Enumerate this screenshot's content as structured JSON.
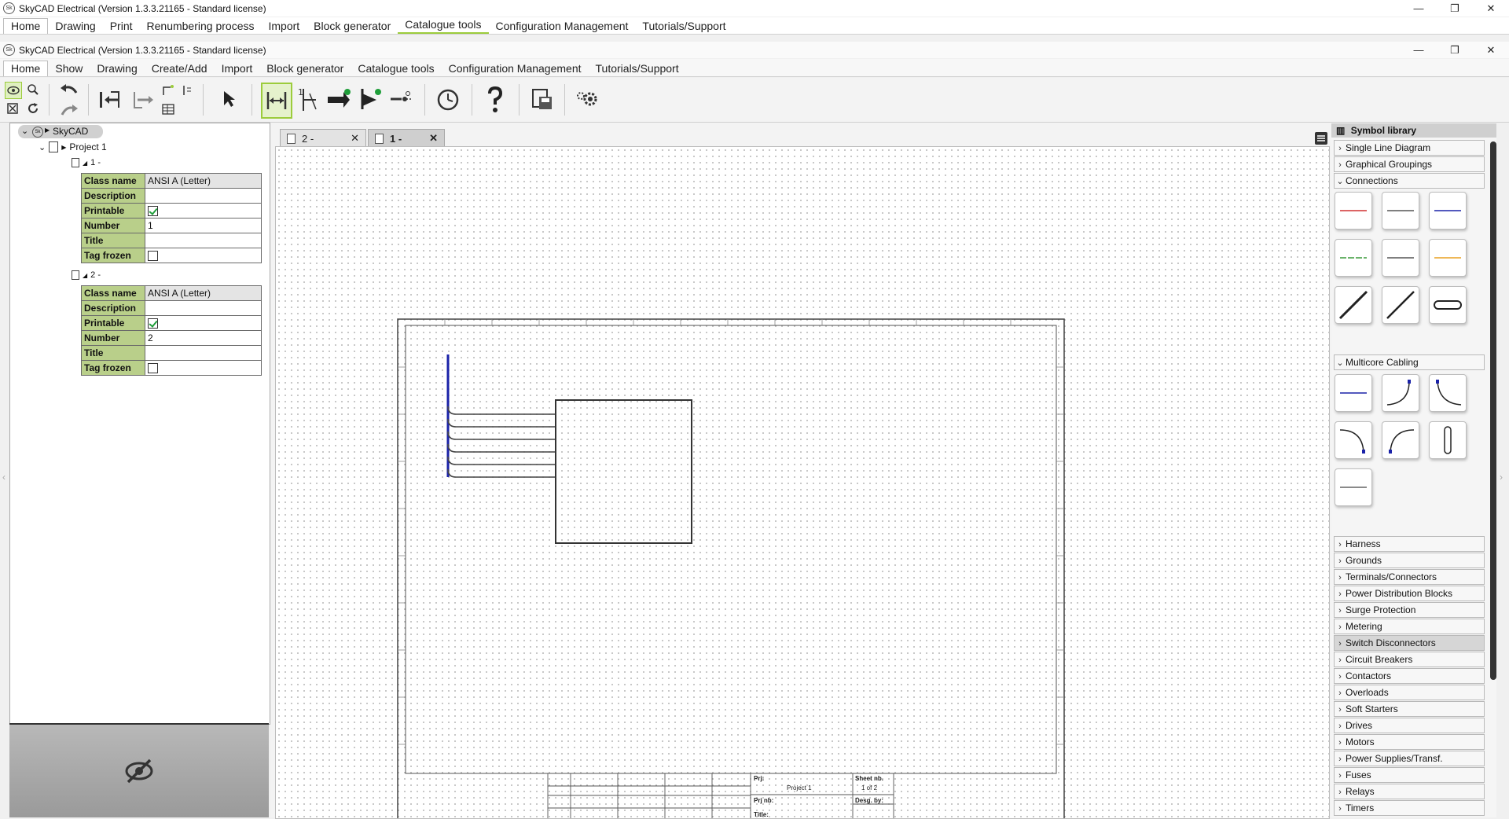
{
  "outer_window": {
    "title": "SkyCAD Electrical (Version 1.3.3.21165 - Standard license)",
    "menu": [
      "Home",
      "Drawing",
      "Print",
      "Renumbering process",
      "Import",
      "Block generator",
      "Catalogue tools",
      "Configuration Management",
      "Tutorials/Support"
    ]
  },
  "inner_window": {
    "title": "SkyCAD Electrical (Version 1.3.3.21165 - Standard license)",
    "menu": [
      "Home",
      "Show",
      "Drawing",
      "Create/Add",
      "Import",
      "Block generator",
      "Catalogue tools",
      "Configuration Management",
      "Tutorials/Support"
    ]
  },
  "window_controls": [
    "—",
    "❐",
    "✕"
  ],
  "tree": {
    "root": "SkyCAD",
    "project": "Project 1",
    "pages": [
      {
        "label": "1 -",
        "props": [
          {
            "key": "Class name",
            "value": "ANSI A (Letter)"
          },
          {
            "key": "Description",
            "value": ""
          },
          {
            "key": "Printable",
            "value": "",
            "checked": true
          },
          {
            "key": "Number",
            "value": "1"
          },
          {
            "key": "Title",
            "value": ""
          },
          {
            "key": "Tag frozen",
            "value": "",
            "checked": false
          }
        ]
      },
      {
        "label": "2 -",
        "props": [
          {
            "key": "Class name",
            "value": "ANSI A (Letter)"
          },
          {
            "key": "Description",
            "value": ""
          },
          {
            "key": "Printable",
            "value": "",
            "checked": true
          },
          {
            "key": "Number",
            "value": "2"
          },
          {
            "key": "Title",
            "value": ""
          },
          {
            "key": "Tag frozen",
            "value": "",
            "checked": false
          }
        ]
      }
    ]
  },
  "tabs": [
    {
      "label": "2 -",
      "active": false
    },
    {
      "label": "1 -",
      "active": true
    }
  ],
  "title_block": {
    "prj_label": "Prj:",
    "project": "Project 1",
    "sheet_label": "Sheet nb.",
    "sheet_value": "1 of 2",
    "prjnb_label": "Prj nb:",
    "desg_label": "Desg. by:",
    "title_label": "Title:"
  },
  "library": {
    "header": "Symbol library",
    "top_categories": [
      "Single Line Diagram",
      "Graphical Groupings",
      "Connections"
    ],
    "multicore_label": "Multicore Cabling",
    "categories": [
      "Harness",
      "Grounds",
      "Terminals/Connectors",
      "Power Distribution Blocks",
      "Surge Protection",
      "Metering",
      "Switch Disconnectors",
      "Circuit Breakers",
      "Contactors",
      "Overloads",
      "Soft Starters",
      "Drives",
      "Motors",
      "Power Supplies/Transf.",
      "Fuses",
      "Relays",
      "Timers"
    ],
    "highlighted": "Switch Disconnectors"
  },
  "colors": {
    "accent_green": "#9ccc3c",
    "prop_key_bg": "#b9cf8a",
    "wire_blue": "#1a22a8",
    "wire_red": "#d03030",
    "wire_orange": "#e8a020"
  }
}
